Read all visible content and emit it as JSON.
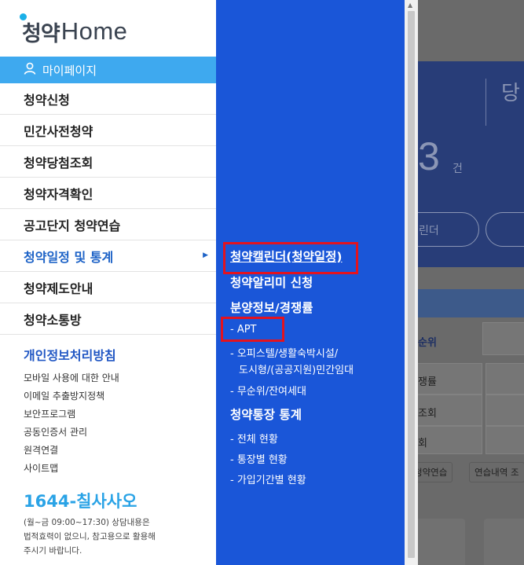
{
  "logo": {
    "korean": "청약",
    "english": "Home"
  },
  "my_page": {
    "label": "마이페이지",
    "icon": "person-icon"
  },
  "menu": [
    {
      "label": "청약신청"
    },
    {
      "label": "민간사전청약"
    },
    {
      "label": "청약당첨조회"
    },
    {
      "label": "청약자격확인"
    },
    {
      "label": "공고단지 청약연습"
    },
    {
      "label": "청약일정 및 통계",
      "active": true,
      "arrow": "▶"
    },
    {
      "label": "청약제도안내"
    },
    {
      "label": "청약소통방"
    }
  ],
  "privacy_title": "개인정보처리방침",
  "footer_links": [
    "모바일 사용에 대한 안내",
    "이메일 추출방지정책",
    "보안프로그램",
    "공동인증서 관리",
    "원격연결",
    "사이트맵"
  ],
  "phone": "1644-칠사사오",
  "notice_lines": [
    "(월~금 09:00~17:30) 상담내용은",
    "법적효력이 없으니, 참고용으로 활용해",
    "주시기 바랍니다."
  ],
  "submenu": {
    "calendar": "청약캘린더(청약일정)",
    "alimi": "청약알리미 신청",
    "sale_info": "분양정보/경쟁률",
    "apt": "- APT",
    "officetel_1": "- 오피스텔/생활숙박시설/",
    "officetel_2": "도시형/(공공지원)민간임대",
    "leftover": "- 무순위/잔여세대",
    "account_stats": "청약통장 통계",
    "total": "- 전체 현황",
    "by_account": "- 통장별 현황",
    "by_period": "- 가입기간별 현황"
  },
  "background": {
    "dang": "당",
    "count": "3",
    "unit": "건",
    "calendar_btn": "린더",
    "rank": "순위",
    "competition": "쟁률",
    "inquiry": "조회",
    "item4": "회",
    "practice_btn": "청약연습",
    "history_btn": "연습내역 조"
  },
  "colors": {
    "mypage_bar": "#3ea9ef",
    "submenu_bg": "#1a56d8",
    "active_menu": "#1e63c7",
    "highlight_box": "#e3131f",
    "phone": "#2aa3e6"
  }
}
